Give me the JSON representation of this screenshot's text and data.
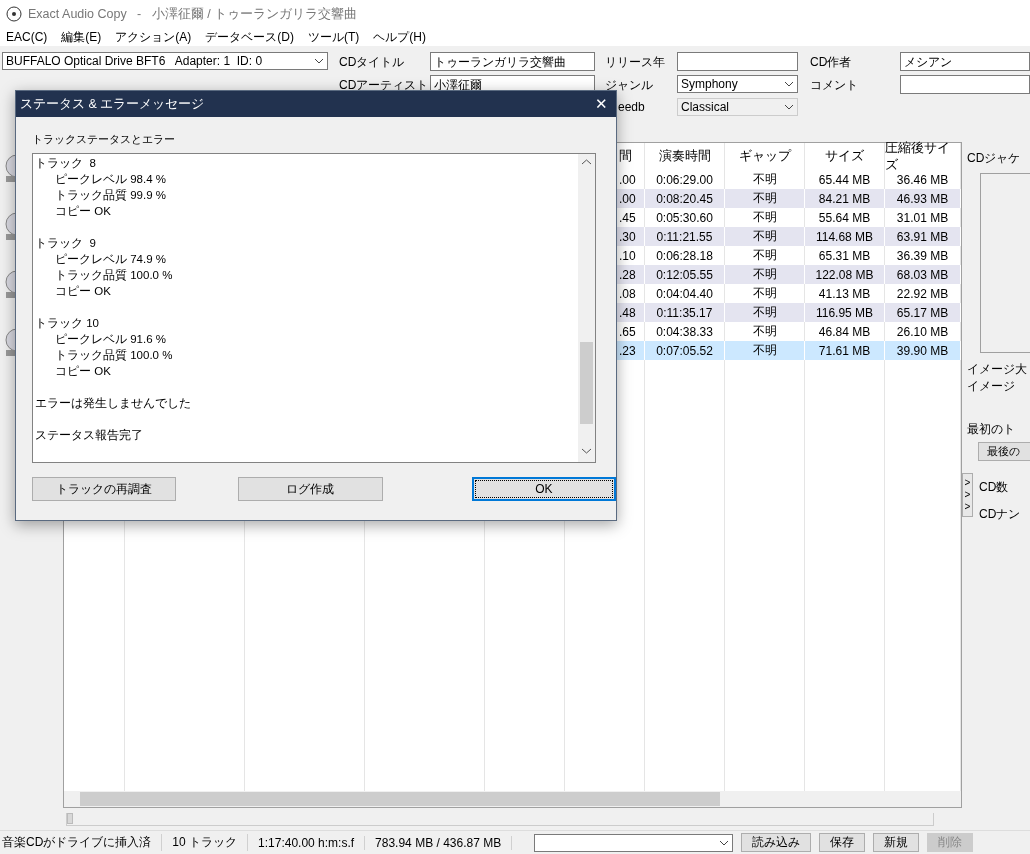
{
  "window": {
    "title": "Exact Audio Copy   -   小澤征爾 / トゥーランガリラ交響曲"
  },
  "menu": [
    "EAC(C)",
    "編集(E)",
    "アクション(A)",
    "データベース(D)",
    "ツール(T)",
    "ヘルプ(H)"
  ],
  "drive": {
    "value": "BUFFALO Optical Drive BFT6   Adapter: 1  ID: 0"
  },
  "metadata_rows": [
    [
      {
        "label": "CDタイトル",
        "value": "トゥーランガリラ交響曲",
        "kind": "text"
      },
      {
        "label": "リリース年",
        "kind": "text"
      },
      {
        "label": "CD作者",
        "value": "メシアン",
        "kind": "text"
      }
    ],
    [
      {
        "label": "CDアーティスト",
        "value": "小澤征爾",
        "kind": "text"
      },
      {
        "label": "ジャンル",
        "value": "Symphony",
        "kind": "select"
      },
      {
        "label": "コメント",
        "kind": "text"
      }
    ],
    [
      {
        "label": "eedb",
        "value": "Classical",
        "kind": "select-disabled"
      }
    ]
  ],
  "table": {
    "columns": [
      "間",
      "演奏時間",
      "ギャップ",
      "サイズ",
      "圧縮後サイズ"
    ],
    "rows": [
      {
        "cells": [
          ".00",
          "0:06:29.00",
          "不明",
          "65.44 MB",
          "36.46 MB"
        ],
        "selected": false
      },
      {
        "cells": [
          ".00",
          "0:08:20.45",
          "不明",
          "84.21 MB",
          "46.93 MB"
        ],
        "selected": false
      },
      {
        "cells": [
          ".45",
          "0:05:30.60",
          "不明",
          "55.64 MB",
          "31.01 MB"
        ],
        "selected": false
      },
      {
        "cells": [
          ".30",
          "0:11:21.55",
          "不明",
          "114.68 MB",
          "63.91 MB"
        ],
        "selected": false
      },
      {
        "cells": [
          ".10",
          "0:06:28.18",
          "不明",
          "65.31 MB",
          "36.39 MB"
        ],
        "selected": false
      },
      {
        "cells": [
          ".28",
          "0:12:05.55",
          "不明",
          "122.08 MB",
          "68.03 MB"
        ],
        "selected": false
      },
      {
        "cells": [
          ".08",
          "0:04:04.40",
          "不明",
          "41.13 MB",
          "22.92 MB"
        ],
        "selected": false
      },
      {
        "cells": [
          ".48",
          "0:11:35.17",
          "不明",
          "116.95 MB",
          "65.17 MB"
        ],
        "selected": false
      },
      {
        "cells": [
          ".65",
          "0:04:38.33",
          "不明",
          "46.84 MB",
          "26.10 MB"
        ],
        "selected": false
      },
      {
        "cells": [
          ".23",
          "0:07:05.52",
          "不明",
          "71.61 MB",
          "39.90 MB"
        ],
        "selected": true
      }
    ]
  },
  "side_panel": {
    "cover_label": "CDジャケ",
    "image_lines": [
      "イメージ大",
      "イメージ"
    ],
    "first_track_label": "最初のト",
    "last_button": "最後の",
    "expand_glyphs": [
      ">",
      ">",
      ">"
    ],
    "cd_count_label": "CD数",
    "cd_number_label": "CDナン"
  },
  "seek_slider": {
    "level": 0
  },
  "status_bar": {
    "fields": [
      "音楽CDがドライブに挿入済",
      "10 トラック",
      "1:17:40.00 h:m:s.f",
      "783.94 MB / 436.87 MB"
    ],
    "buttons": [
      {
        "label": "読み込み",
        "disabled": false
      },
      {
        "label": "保存",
        "disabled": false
      },
      {
        "label": "新規",
        "disabled": false
      },
      {
        "label": "削除",
        "disabled": true
      }
    ]
  },
  "dialog": {
    "title": "ステータス & エラーメッセージ",
    "close": "✕",
    "group_label": "トラックステータスとエラー",
    "tracks": [
      {
        "title": "トラック  8",
        "lines": [
          "ピークレベル 98.4 %",
          "トラック品質 99.9 %",
          "コピー OK"
        ]
      },
      {
        "title": "トラック  9",
        "lines": [
          "ピークレベル 74.9 %",
          "トラック品質 100.0 %",
          "コピー OK"
        ]
      },
      {
        "title": "トラック 10",
        "lines": [
          "ピークレベル 91.6 %",
          "トラック品質 100.0 %",
          "コピー OK"
        ]
      }
    ],
    "messages": [
      "エラーは発生しませんでした",
      "ステータス報告完了"
    ],
    "buttons": [
      {
        "label": "トラックの再調査",
        "focused": false
      },
      {
        "label": "ログ作成",
        "focused": false
      },
      {
        "label": "OK",
        "focused": true
      }
    ]
  }
}
